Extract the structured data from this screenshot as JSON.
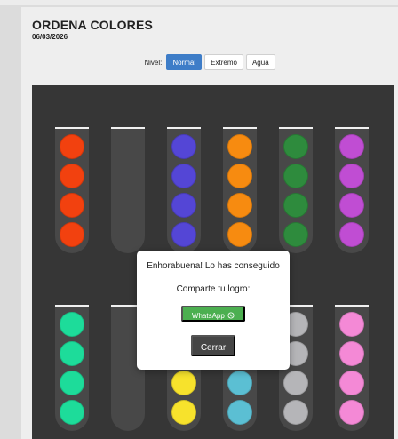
{
  "header": {
    "title": "ORDENA COLORES",
    "date": "06/03/2026"
  },
  "levels": {
    "label": "Nivel:",
    "options": [
      "Normal",
      "Extremo",
      "Agua"
    ],
    "selected": "Normal"
  },
  "colors": {
    "red": "#f2410f",
    "blue": "#5446d6",
    "orange": "#f78b10",
    "green": "#2e8b3d",
    "purple": "#c04dd3",
    "teal": "#1ddc9a",
    "yellow": "#f7e22c",
    "cyan": "#5bbfd3",
    "gray": "#b5b5b8",
    "pink": "#f489d6",
    "accent": "#3e7dc8",
    "whatsapp": "#4caf50"
  },
  "game": {
    "tubes_row1": [
      [
        "red",
        "red",
        "red",
        "red"
      ],
      [],
      [
        "blue",
        "blue",
        "blue",
        "blue"
      ],
      [
        "orange",
        "orange",
        "orange",
        "orange"
      ],
      [
        "green",
        "green",
        "green",
        "green"
      ],
      [
        "purple",
        "purple",
        "purple",
        "purple"
      ]
    ],
    "tubes_row2": [
      [
        "teal",
        "teal",
        "teal",
        "teal"
      ],
      [],
      [
        "yellow",
        "yellow",
        "yellow",
        "yellow"
      ],
      [
        "cyan",
        "cyan",
        "cyan",
        "cyan"
      ],
      [
        "gray",
        "gray",
        "gray",
        "gray"
      ],
      [
        "pink",
        "pink",
        "pink",
        "pink"
      ]
    ]
  },
  "modal": {
    "message": "Enhorabuena! Lo has conseguido",
    "share_label": "Comparte tu logro:",
    "whatsapp_label": "WhatsApp",
    "whatsapp_icon": "whatsapp-icon",
    "close_label": "Cerrar"
  }
}
